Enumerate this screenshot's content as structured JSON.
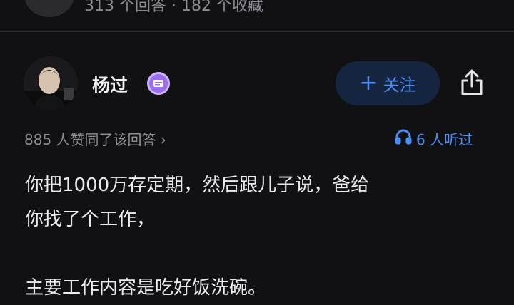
{
  "question": {
    "stats_text": "313 个回答 · 182 个收藏"
  },
  "author": {
    "name": "杨过",
    "follow_label": "关注",
    "follow_plus": "+"
  },
  "meta": {
    "upvote_text": "885 人赞同了该回答 ›",
    "listen_text": "6 人听过"
  },
  "answer": {
    "para1_line1": "你把1000万存定期，然后跟儿子说，爸给",
    "para1_line2": "你找了个工作，",
    "para2": "主要工作内容是吃好饭洗碗。"
  },
  "icons": {
    "badge": "verified-badge-icon",
    "share": "share-icon",
    "listen": "headphones-icon"
  },
  "colors": {
    "background": "#111114",
    "accent": "#4d8ff5",
    "badge": "#9b6cf0"
  }
}
